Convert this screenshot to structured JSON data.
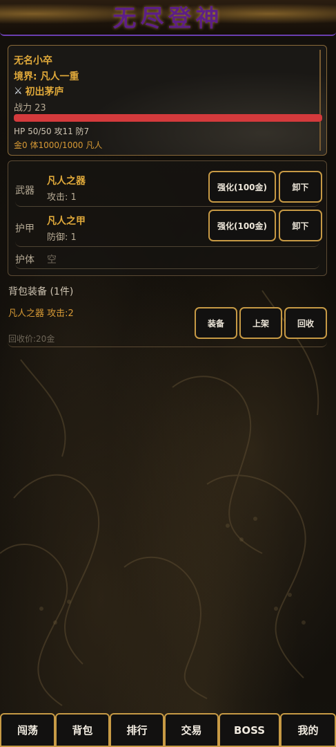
{
  "header": {
    "title": "无尽登神"
  },
  "character": {
    "name": "无名小卒",
    "realm": "境界: 凡人一重",
    "title_icon": "crossed-swords-icon",
    "title": "初出茅庐",
    "power": "战力 23",
    "hp_fraction": 1.0,
    "stats": "HP 50/50 攻11 防7",
    "gold_line": "金0 体1000/1000 凡人"
  },
  "equipment": {
    "slots": [
      {
        "label": "武器",
        "item": "凡人之器",
        "stat": "攻击: 1",
        "enhance": "强化(100金)",
        "unequip": "卸下"
      },
      {
        "label": "护甲",
        "item": "凡人之甲",
        "stat": "防御: 1",
        "enhance": "强化(100金)",
        "unequip": "卸下"
      },
      {
        "label": "护体",
        "empty": "空"
      }
    ]
  },
  "bag": {
    "title": "背包装备 (1件)",
    "items": [
      {
        "name": "凡人之器 攻击:2",
        "price": "回收价:20金",
        "equip": "装备",
        "list": "上架",
        "recycle": "回收"
      }
    ]
  },
  "nav": {
    "tabs": [
      "闯荡",
      "背包",
      "排行",
      "交易",
      "BOSS",
      "我的"
    ]
  },
  "colors": {
    "accent_gold": "#e0a93a",
    "button_border": "#c79a45",
    "hp_bar": "#d43a3c",
    "title_purple": "#5d1f86"
  }
}
